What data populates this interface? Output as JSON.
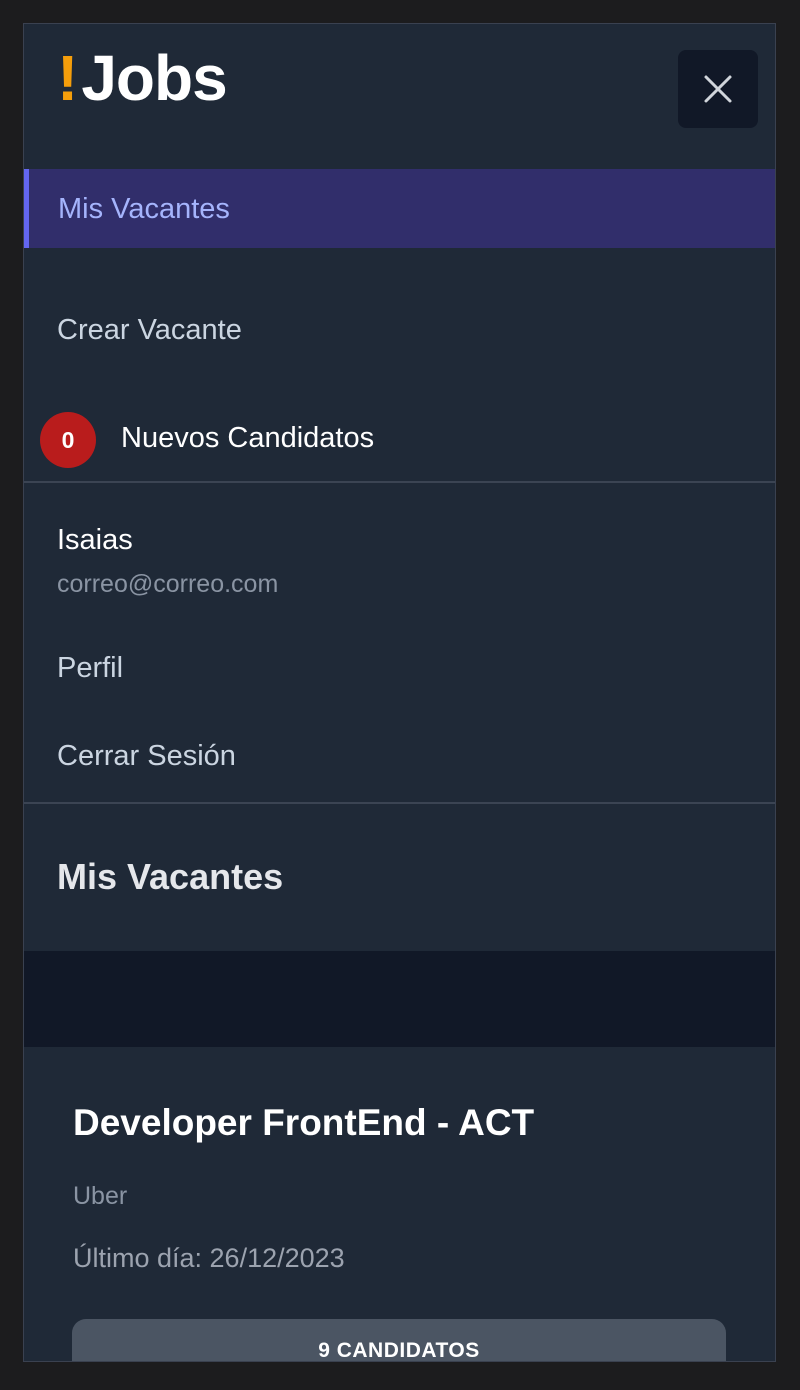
{
  "app": {
    "logo_mark": "!",
    "logo_word": "Jobs"
  },
  "header": {
    "close_icon": "close-icon"
  },
  "nav": {
    "active_item": "Mis Vacantes",
    "items": [
      {
        "label": "Crear Vacante"
      },
      {
        "label": "Nuevos Candidatos",
        "badge_count": "0"
      }
    ]
  },
  "user": {
    "name": "Isaias",
    "email": "correo@correo.com",
    "links": [
      "Perfil",
      "Cerrar Sesión"
    ]
  },
  "section": {
    "title": "Mis Vacantes"
  },
  "vacancy": {
    "title": "Developer FrontEnd - ACT",
    "company": "Uber",
    "deadline": "Último día: 26/12/2023",
    "candidates_button": "9 CANDIDATOS"
  },
  "colors": {
    "accent": "#6366f1",
    "logo_accent": "#f59e0b",
    "badge": "#b91c1c"
  }
}
